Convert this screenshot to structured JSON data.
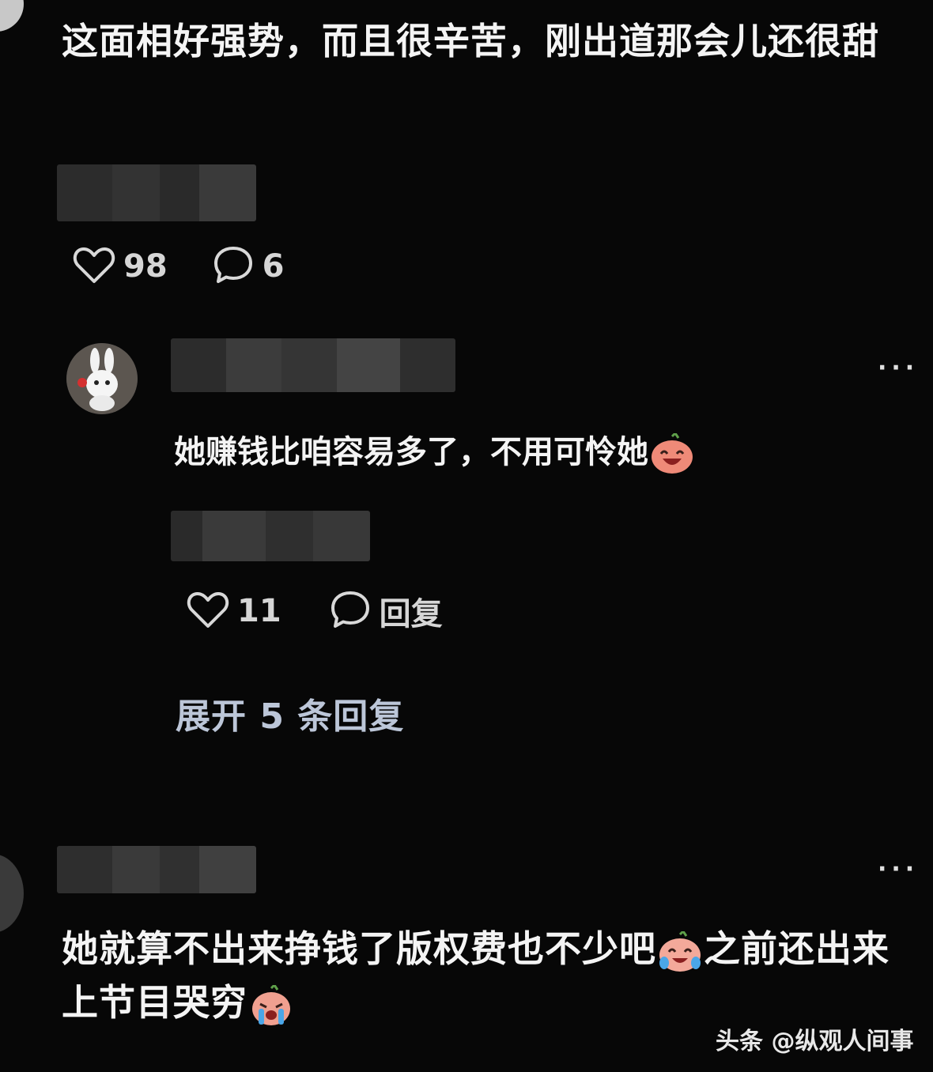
{
  "thread": [
    {
      "text": "这面相好强势，而且很辛苦，刚出道那会儿还很甜",
      "likes": "98",
      "replies": "6",
      "username_blurred": true
    },
    {
      "text": "她赚钱比咱容易多了，不用可怜她",
      "emoji_after": "laughing-face-emoji",
      "likes": "11",
      "reply_label": "回复",
      "expand_label": "展开 5 条回复",
      "more_label": "···"
    },
    {
      "text_part1": "她就算不出来挣钱了版权费也不少吧",
      "emoji_mid": "laughing-tears-emoji",
      "text_part2": "之前还出来上节目哭穷",
      "emoji_end": "crying-emoji",
      "more_label": "···"
    }
  ],
  "watermark": "头条 @纵观人间事",
  "colors": {
    "background": "#070707",
    "text": "#f4f4f4",
    "expand": "#bcc6d8"
  }
}
